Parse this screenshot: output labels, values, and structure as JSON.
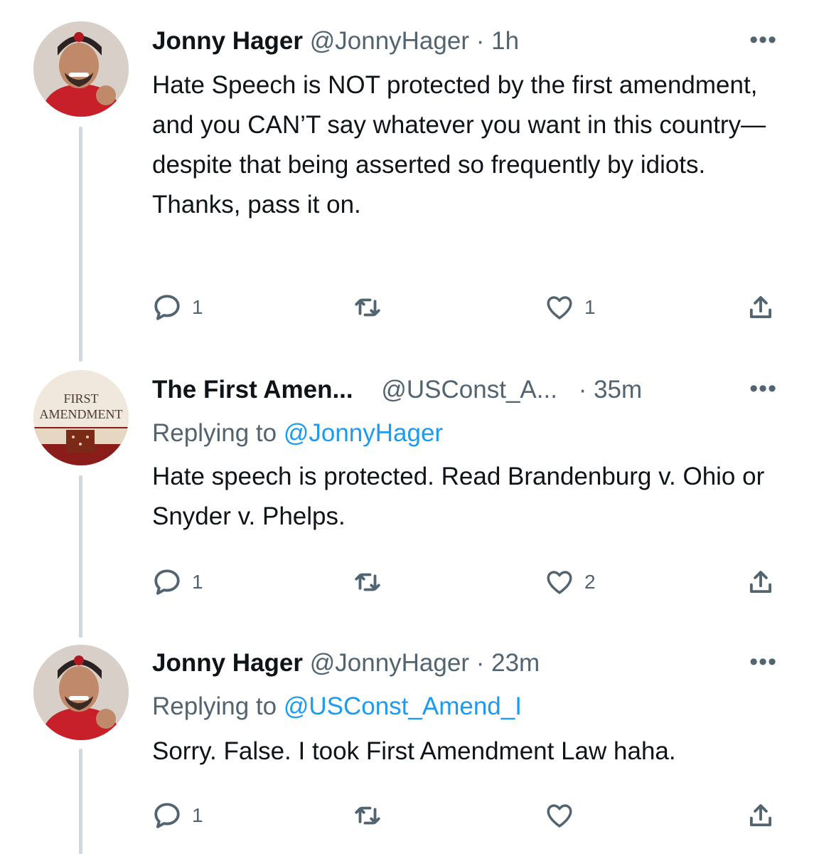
{
  "tweets": [
    {
      "name": "Jonny Hager",
      "handle": "@JonnyHager",
      "time": " · 1h",
      "reply_prefix": "",
      "reply_to": "",
      "text": "Hate Speech is NOT protected by the first amendment, and you CAN’T say whatever you want in this country—despite that being asserted so frequently by idiots. Thanks, pass it on.",
      "replies": "1",
      "retweets": "",
      "likes": "1",
      "avatar": "man-red-hoodie-avatar"
    },
    {
      "name": "The First Amen...",
      "handle": "@USConst_A...",
      "time": "· 35m",
      "reply_prefix": "Replying to ",
      "reply_to": "@JonnyHager",
      "text": "Hate speech is protected. Read Brandenburg v. Ohio or Snyder v. Phelps.",
      "replies": "1",
      "retweets": "",
      "likes": "2",
      "avatar": "first-amendment-logo-avatar",
      "avatar_text_line1": "FIRST",
      "avatar_text_line2": "AMENDMENT"
    },
    {
      "name": "Jonny Hager",
      "handle": "@JonnyHager",
      "time": " · 23m",
      "reply_prefix": "Replying to ",
      "reply_to": "@USConst_Amend_I",
      "text": "Sorry. False. I took First Amendment Law haha.",
      "replies": "1",
      "retweets": "",
      "likes": "",
      "avatar": "man-red-hoodie-avatar"
    }
  ],
  "icons": {
    "more": "more-icon",
    "reply": "reply-icon",
    "retweet": "retweet-icon",
    "like": "heart-icon",
    "share": "share-icon"
  },
  "colors": {
    "text": "#0f1419",
    "secondary": "#536471",
    "link": "#1d9bf0",
    "thread_line": "#cfd9de"
  }
}
